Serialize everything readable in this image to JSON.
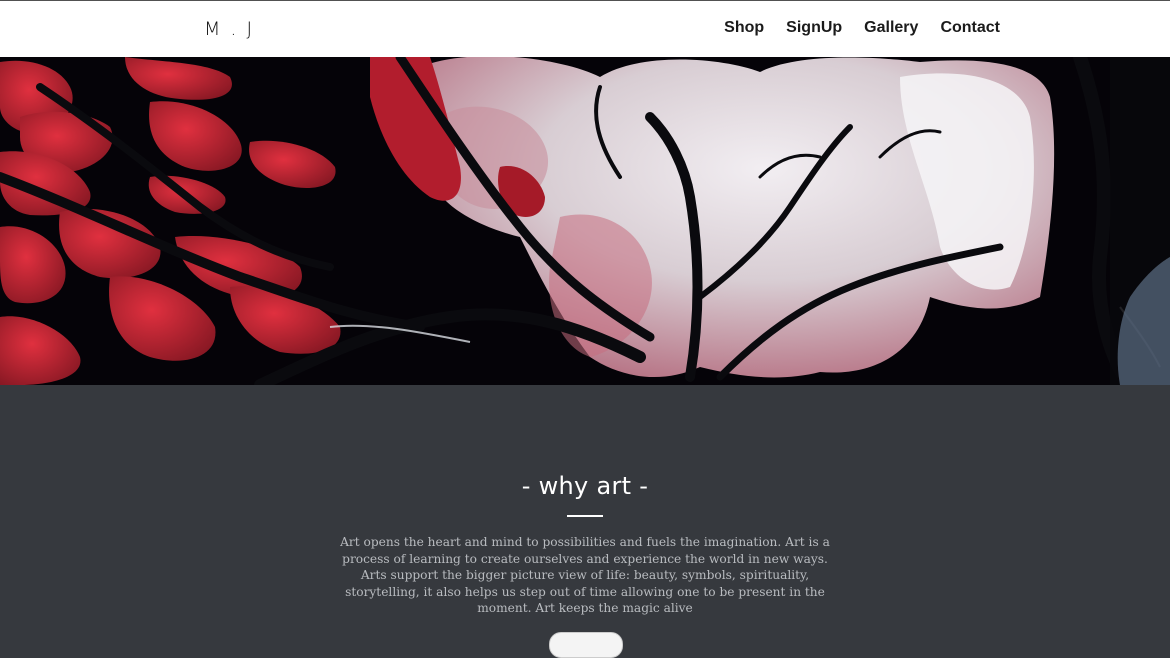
{
  "brand": {
    "logo_text": "M . J"
  },
  "nav": {
    "items": [
      {
        "label": "Shop"
      },
      {
        "label": "SignUp"
      },
      {
        "label": "Gallery"
      },
      {
        "label": "Contact"
      }
    ]
  },
  "hero": {
    "image_icon": "tree-painting-image",
    "colors": {
      "background": "#050308",
      "leaves": "#b5202e",
      "blossom": "#d9c3c9"
    }
  },
  "about": {
    "title": "- why art -",
    "body": "Art opens the heart and mind to possibilities and fuels the imagination. Art is a process of learning to create ourselves and experience the world in new ways. Arts support the bigger picture view of life: beauty, symbols, spirituality, storytelling, it also helps us step out of time allowing one to be present in the moment. Art keeps the magic alive"
  },
  "colors": {
    "section_bg": "#36393e",
    "nav_bg": "#ffffff",
    "text_muted": "#b9bcc0"
  }
}
